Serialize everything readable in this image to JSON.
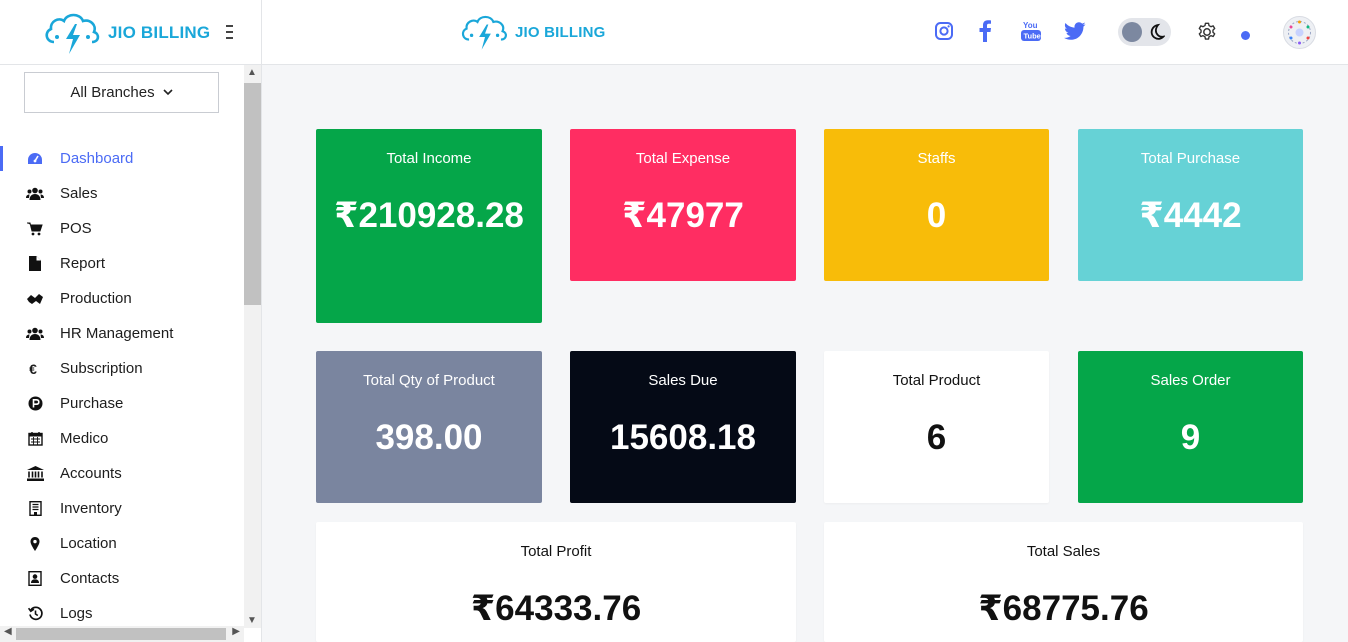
{
  "brand": {
    "name": "JIO BILLING"
  },
  "header": {
    "social": [
      "instagram-icon",
      "facebook-icon",
      "youtube-icon",
      "twitter-icon"
    ],
    "youtube_text": "You Tube"
  },
  "sidebar": {
    "branch_select": "All Branches",
    "items": [
      {
        "label": "Dashboard",
        "icon": "dashboard-icon",
        "active": true
      },
      {
        "label": "Sales",
        "icon": "users-icon"
      },
      {
        "label": "POS",
        "icon": "cart-icon"
      },
      {
        "label": "Report",
        "icon": "file-icon"
      },
      {
        "label": "Production",
        "icon": "production-icon"
      },
      {
        "label": "HR Management",
        "icon": "users-icon"
      },
      {
        "label": "Subscription",
        "icon": "euro-icon"
      },
      {
        "label": "Purchase",
        "icon": "purchase-icon"
      },
      {
        "label": "Medico",
        "icon": "calendar-icon"
      },
      {
        "label": "Accounts",
        "icon": "bank-icon"
      },
      {
        "label": "Inventory",
        "icon": "inventory-icon"
      },
      {
        "label": "Location",
        "icon": "location-pin-icon"
      },
      {
        "label": "Contacts",
        "icon": "contacts-icon"
      },
      {
        "label": "Logs",
        "icon": "history-icon"
      }
    ]
  },
  "cards": {
    "total_income": {
      "title": "Total Income",
      "value": "₹210928.28",
      "color": "#05a649"
    },
    "total_expense": {
      "title": "Total Expense",
      "value": "₹47977",
      "color": "#ff2d62"
    },
    "staffs": {
      "title": "Staffs",
      "value": "0",
      "color": "#f8bc09"
    },
    "total_purchase": {
      "title": "Total Purchase",
      "value": "₹4442",
      "color": "#66d2d6"
    },
    "total_qty": {
      "title": "Total Qty of Product",
      "value": "398.00",
      "color": "#7a859f"
    },
    "sales_due": {
      "title": "Sales Due",
      "value": "15608.18",
      "color": "#050a16"
    },
    "total_product": {
      "title": "Total Product",
      "value": "6",
      "color": "#ffffff"
    },
    "sales_order": {
      "title": "Sales Order",
      "value": "9",
      "color": "#05a649"
    },
    "total_profit": {
      "title": "Total Profit",
      "value": "₹64333.76",
      "color": "#ffffff"
    },
    "total_sales": {
      "title": "Total Sales",
      "value": "₹68775.76",
      "color": "#ffffff"
    }
  },
  "colors": {
    "accent": "#4b6bf5",
    "brand": "#1aa7d9"
  }
}
